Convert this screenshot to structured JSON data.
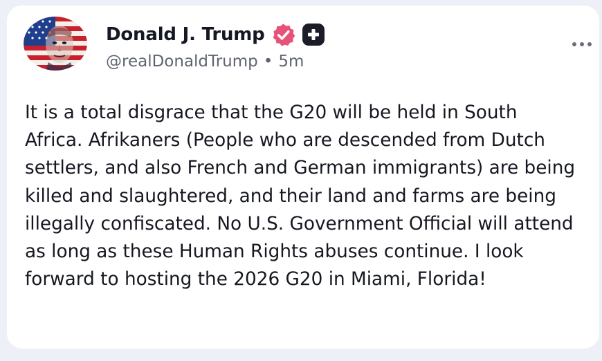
{
  "post": {
    "author": {
      "display_name": "Donald J. Trump",
      "handle": "@realDonaldTrump",
      "separator": "•",
      "time_ago": "5m",
      "avatar_icon": "american-flag-portrait-avatar",
      "verified_icon": "verified-badge-icon",
      "badge_icon": "plus-badge-icon"
    },
    "text": "It is a total disgrace that the G20 will be held in South Africa. Afrikaners (People who are descended from Dutch settlers, and also French and German immigrants) are being killed and slaughtered, and their land and farms are being illegally confiscated. No U.S. Government Official will attend as long as these Human Rights abuses continue. I look forward to hosting the 2026 G20 in Miami, Florida!",
    "menu_icon": "more-options-icon"
  },
  "colors": {
    "background": "#eef0f8",
    "card": "#ffffff",
    "verified_badge": "#e8527a",
    "text": "#161821",
    "muted": "#5f6472"
  }
}
